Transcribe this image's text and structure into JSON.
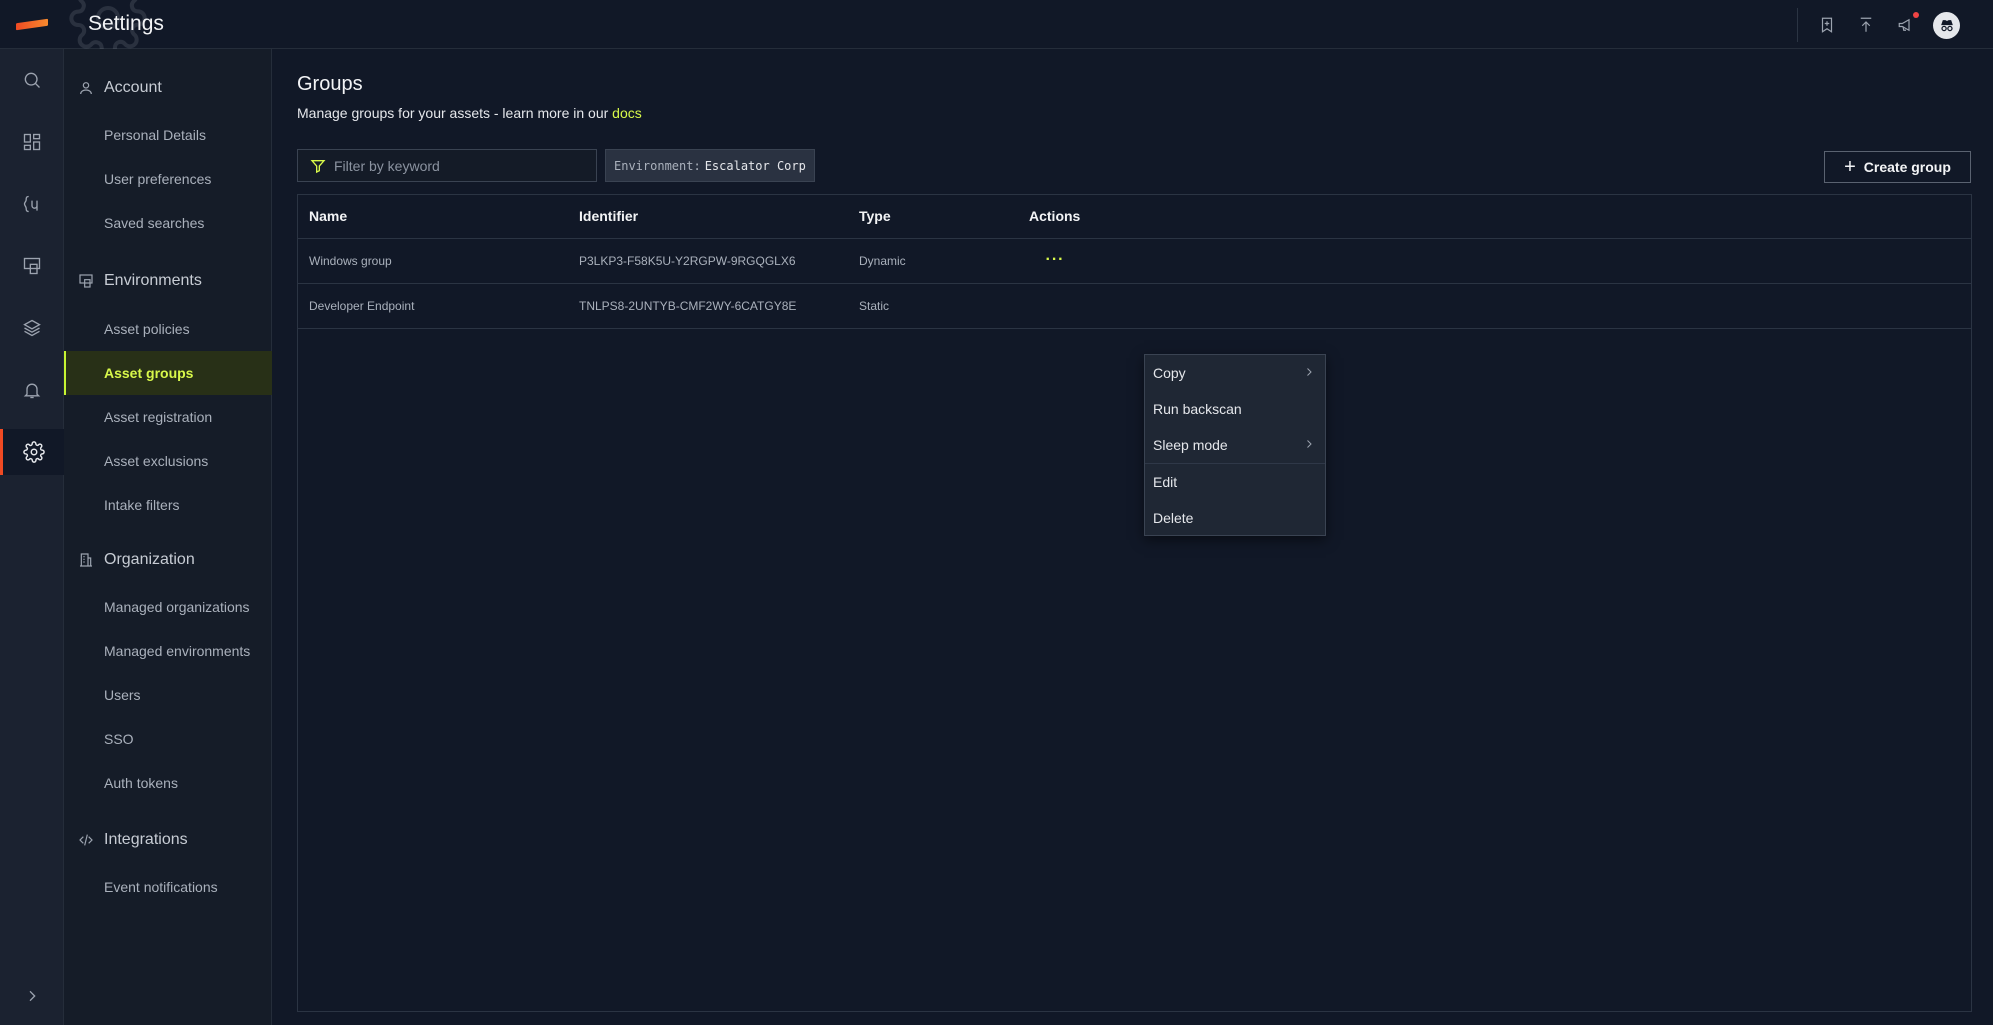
{
  "app": {
    "title": "Settings"
  },
  "sidebar": {
    "sections": [
      {
        "label": "Account",
        "items": [
          "Personal Details",
          "User preferences",
          "Saved searches"
        ]
      },
      {
        "label": "Environments",
        "items": [
          "Asset policies",
          "Asset groups",
          "Asset registration",
          "Asset exclusions",
          "Intake filters"
        ]
      },
      {
        "label": "Organization",
        "items": [
          "Managed organizations",
          "Managed environments",
          "Users",
          "SSO",
          "Auth tokens"
        ]
      },
      {
        "label": "Integrations",
        "items": [
          "Event notifications"
        ]
      }
    ],
    "active_item": "Asset groups"
  },
  "page": {
    "title": "Groups",
    "subtitle": "Manage groups for your assets - learn more in our",
    "docs_link": "docs"
  },
  "filter": {
    "placeholder": "Filter by keyword"
  },
  "environment_chip": {
    "key": "Environment:",
    "value": "Escalator Corp"
  },
  "create_button": {
    "label": "Create group"
  },
  "table": {
    "headers": [
      "Name",
      "Identifier",
      "Type",
      "Actions"
    ],
    "rows": [
      {
        "name": "Windows group",
        "identifier": "P3LKP3-F58K5U-Y2RGPW-9RGQGLX6",
        "type": "Dynamic"
      },
      {
        "name": "Developer Endpoint",
        "identifier": "TNLPS8-2UNTYB-CMF2WY-6CATGY8E",
        "type": "Static"
      }
    ]
  },
  "context_menu": {
    "items": [
      "Copy",
      "Run backscan",
      "Sleep mode",
      "Edit",
      "Delete"
    ]
  },
  "colors": {
    "accent": "#d8f84a",
    "brand": "#f04a23",
    "background": "#111827"
  }
}
